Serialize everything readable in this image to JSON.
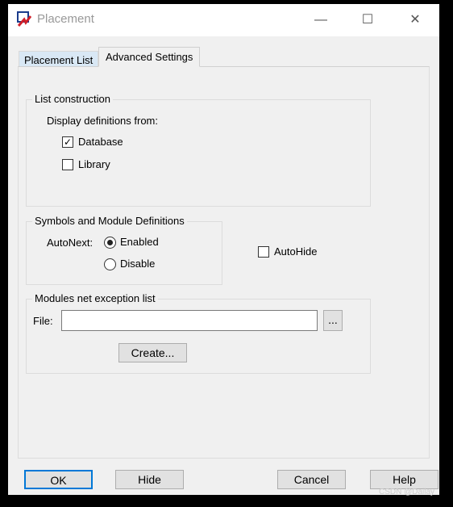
{
  "window": {
    "title": "Placement",
    "minimize": "—",
    "maximize": "☐",
    "close": "✕"
  },
  "tabs": [
    {
      "label": "Placement List",
      "active": false
    },
    {
      "label": "Advanced Settings",
      "active": true
    }
  ],
  "list_construction": {
    "title": "List construction",
    "display_from": "Display definitions from:",
    "database": {
      "label": "Database",
      "checked": true
    },
    "library": {
      "label": "Library",
      "checked": false
    }
  },
  "symbols": {
    "title": "Symbols and Module Definitions",
    "autonext": "AutoNext:",
    "enabled": {
      "label": "Enabled",
      "selected": true
    },
    "disable": {
      "label": "Disable",
      "selected": false
    }
  },
  "autohide": {
    "label": "AutoHide",
    "checked": false
  },
  "modules": {
    "title": "Modules net exception list",
    "file_label": "File:",
    "file_value": "",
    "browse": "...",
    "create": "Create..."
  },
  "buttons": {
    "ok": "OK",
    "hide": "Hide",
    "cancel": "Cancel",
    "help": "Help"
  },
  "watermark": "CSDN @Dailay"
}
